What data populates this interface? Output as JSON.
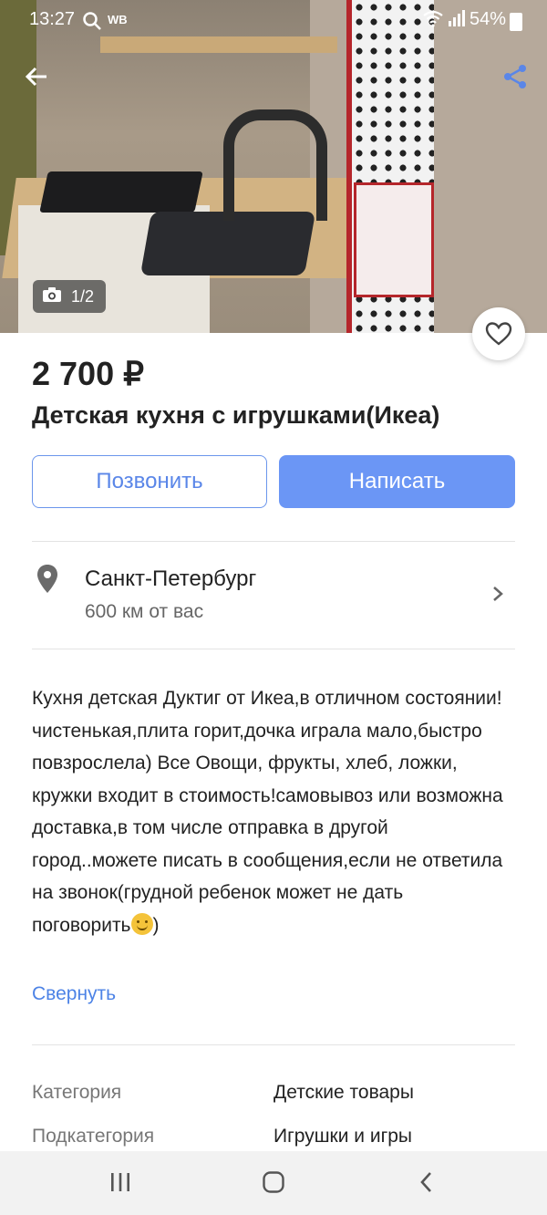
{
  "status_bar": {
    "time": "13:27",
    "carrier_tag": "WB",
    "battery": "54%"
  },
  "gallery": {
    "counter": "1/2"
  },
  "listing": {
    "price": "2 700 ₽",
    "title": "Детская кухня с игрушками(Икеа)"
  },
  "actions": {
    "call_label": "Позвонить",
    "write_label": "Написать"
  },
  "location": {
    "city": "Санкт-Петербург",
    "distance": "600 км от вас"
  },
  "description": {
    "text": "Кухня детская Дуктиг от Икеа,в отличном состоянии!чистенькая,плита горит,дочка играла мало,быстро повзрослела) Все Овощи, фрукты, хлеб, ложки, кружки входит в стоимость!самовывоз или возможна доставка,в том числе отправка в другой город..можете писать в сообщения,если не ответила на звонок(грудной ребенок может не дать поговорить",
    "text_end": ")",
    "collapse_label": "Свернуть"
  },
  "params": [
    {
      "label": "Категория",
      "value": "Детские товары"
    },
    {
      "label": "Подкатегория",
      "value": "Игрушки и игры"
    }
  ],
  "colors": {
    "accent": "#6b96f5",
    "link": "#4d83e6"
  }
}
